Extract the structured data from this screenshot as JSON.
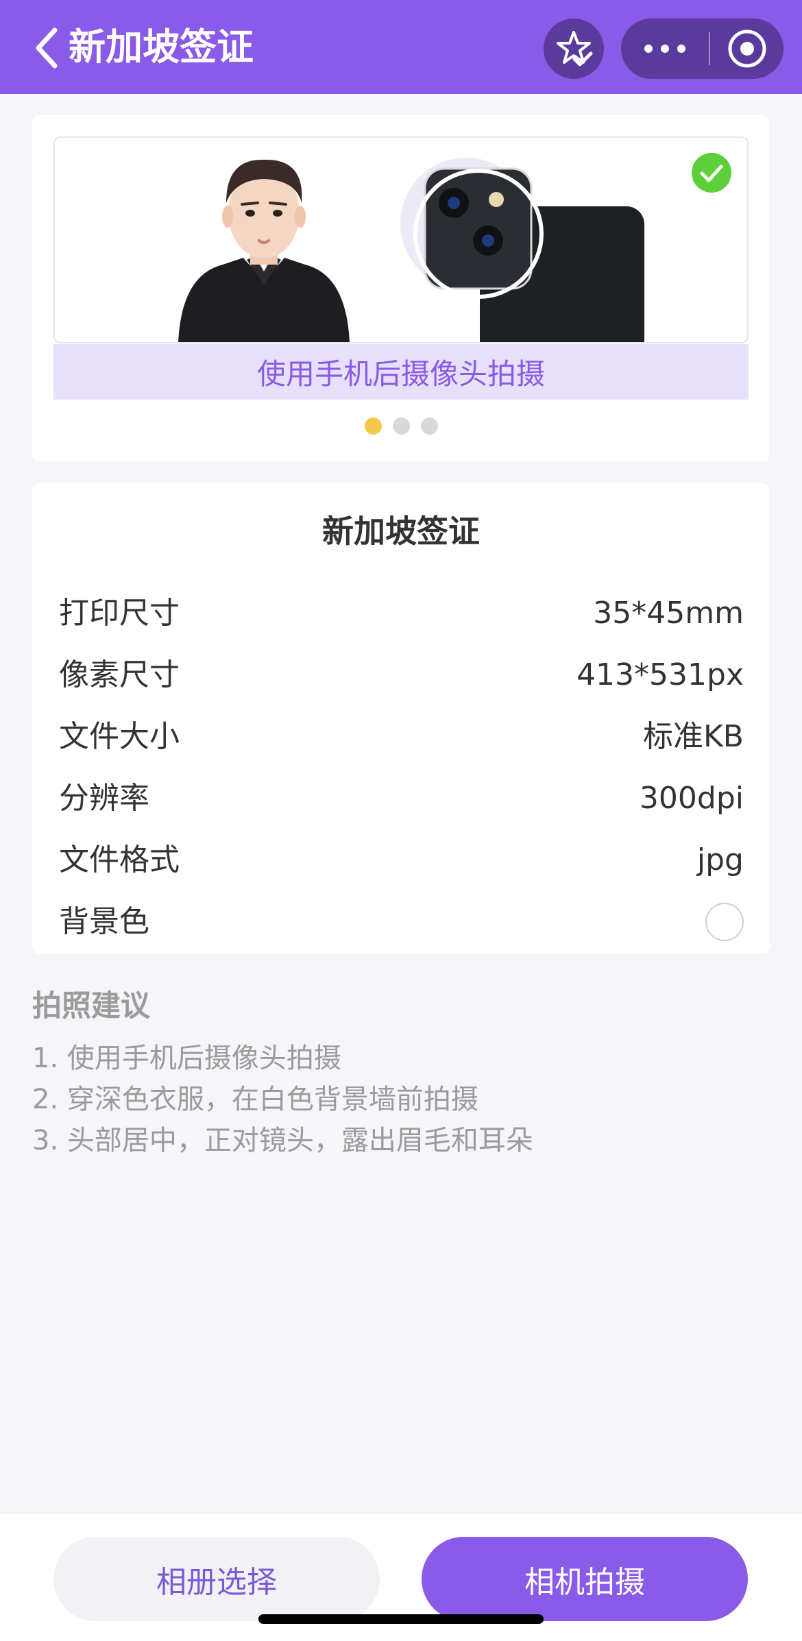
{
  "header": {
    "title": "新加坡签证",
    "back_icon": "chevron-left-icon",
    "favorite_icon": "star-check-icon",
    "more_icon": "more-dots-icon",
    "close_icon": "target-close-icon",
    "bar_color": "#8a5ae8"
  },
  "carousel": {
    "caption": "使用手机后摄像头拍摄",
    "check_icon": "check-circle-icon",
    "dots": 3,
    "active_dot": 0
  },
  "spec": {
    "title": "新加坡签证",
    "rows": [
      {
        "label": "打印尺寸",
        "value": "35*45mm"
      },
      {
        "label": "像素尺寸",
        "value": "413*531px"
      },
      {
        "label": "文件大小",
        "value": "标准KB"
      },
      {
        "label": "分辨率",
        "value": "300dpi"
      },
      {
        "label": "文件格式",
        "value": "jpg"
      }
    ],
    "background_label": "背景色",
    "background_color": "#ffffff"
  },
  "tips": {
    "title": "拍照建议",
    "items": [
      "1. 使用手机后摄像头拍摄",
      "2. 穿深色衣服，在白色背景墙前拍摄",
      "3. 头部居中，正对镜头，露出眉毛和耳朵"
    ]
  },
  "actions": {
    "album_label": "相册选择",
    "camera_label": "相机拍摄"
  }
}
